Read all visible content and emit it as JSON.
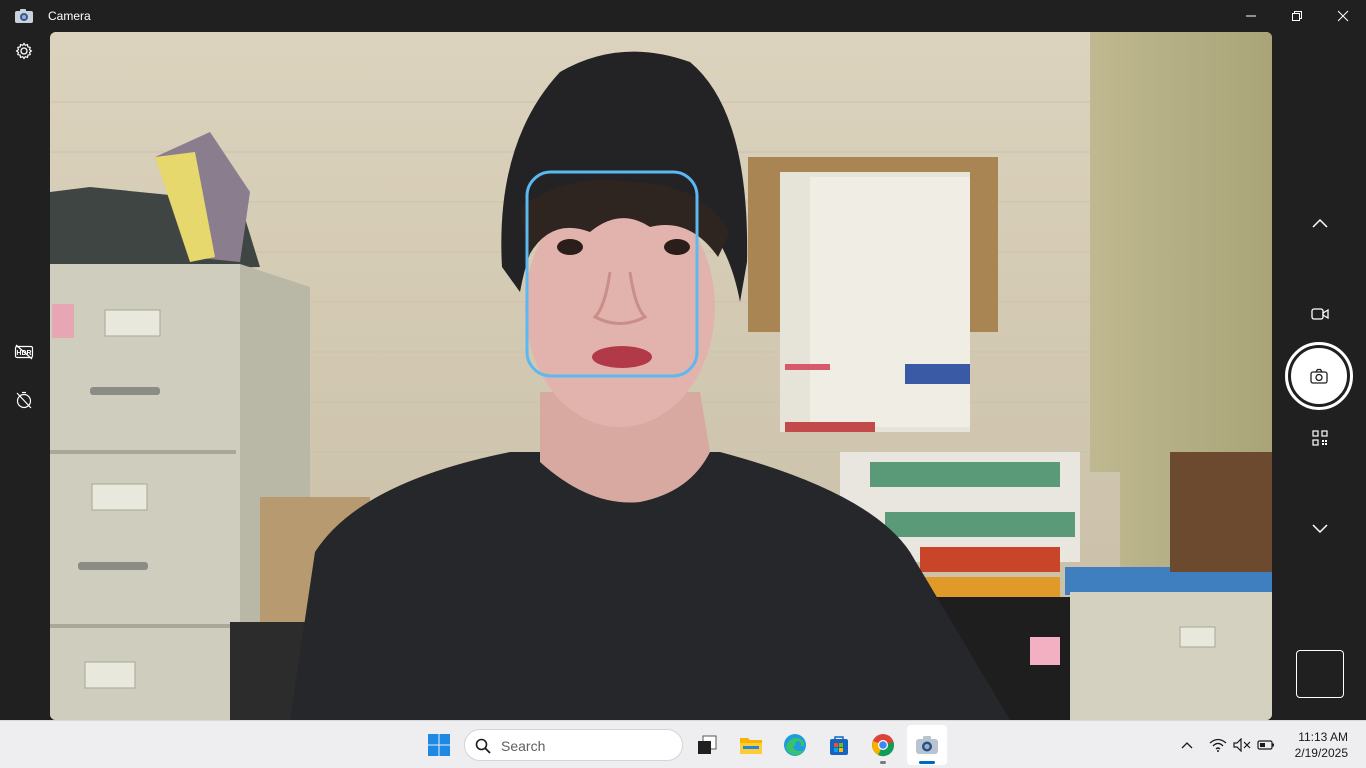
{
  "window": {
    "title": "Camera",
    "icon": "camera-app-icon"
  },
  "window_controls": {
    "minimize": "minimize-icon",
    "maximize": "restore-icon",
    "close": "close-icon"
  },
  "left_toolbar": {
    "settings": "gear-icon",
    "hdr": "hdr-icon",
    "timer": "timer-off-icon"
  },
  "right_toolbar": {
    "scroll_up": "chevron-up-icon",
    "video_mode": "video-camera-icon",
    "photo_capture": "camera-shutter-icon",
    "qr_mode": "qr-code-icon",
    "scroll_down": "chevron-down-icon",
    "last_capture": "thumbnail"
  },
  "viewfinder": {
    "face_detection": true,
    "face_box_color": "#5bb8f0"
  },
  "taskbar": {
    "search_placeholder": "Search",
    "apps": [
      "windows-start-icon",
      "task-view-icon",
      "file-explorer-icon",
      "edge-icon",
      "store-icon",
      "chrome-icon",
      "camera-icon"
    ],
    "time": "11:13 AM",
    "date": "2/19/2025"
  },
  "colors": {
    "accent": "#0067c0",
    "frame": "#202020",
    "taskbar": "#eeeef1"
  }
}
